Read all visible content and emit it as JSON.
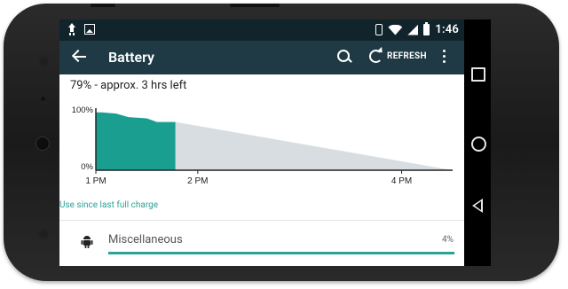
{
  "status_bar": {
    "time": "1:46"
  },
  "app_bar": {
    "title": "Battery",
    "refresh_label": "REFRESH"
  },
  "battery": {
    "status_text": "79% - approx. 3 hrs left",
    "use_since_label": "Use since last full charge"
  },
  "chart_data": {
    "type": "area",
    "y_axis_labels": [
      "100%",
      "0%"
    ],
    "x_tick_labels": [
      "1 PM",
      "2 PM",
      "4 PM"
    ],
    "history_series": {
      "name": "",
      "color": "#1a9e90",
      "x_hours": [
        0.0,
        0.06,
        0.2,
        0.32,
        0.5,
        0.6,
        0.78
      ],
      "y_percent": [
        96,
        96,
        94,
        88,
        86,
        80,
        80
      ]
    },
    "projection_series": {
      "name": "",
      "color": "#d7dde1",
      "x_hours": [
        0.78,
        3.5
      ],
      "y_percent": [
        80,
        0
      ]
    },
    "x_range": [
      0,
      3.5
    ],
    "y_range": [
      0,
      100
    ]
  },
  "usage_list": [
    {
      "label": "Miscellaneous",
      "percent_text": "4%",
      "fraction": 1.0
    }
  ],
  "colors": {
    "accent": "#2aa394",
    "app_bar": "#1f3a45",
    "status_bar": "#11242b"
  }
}
